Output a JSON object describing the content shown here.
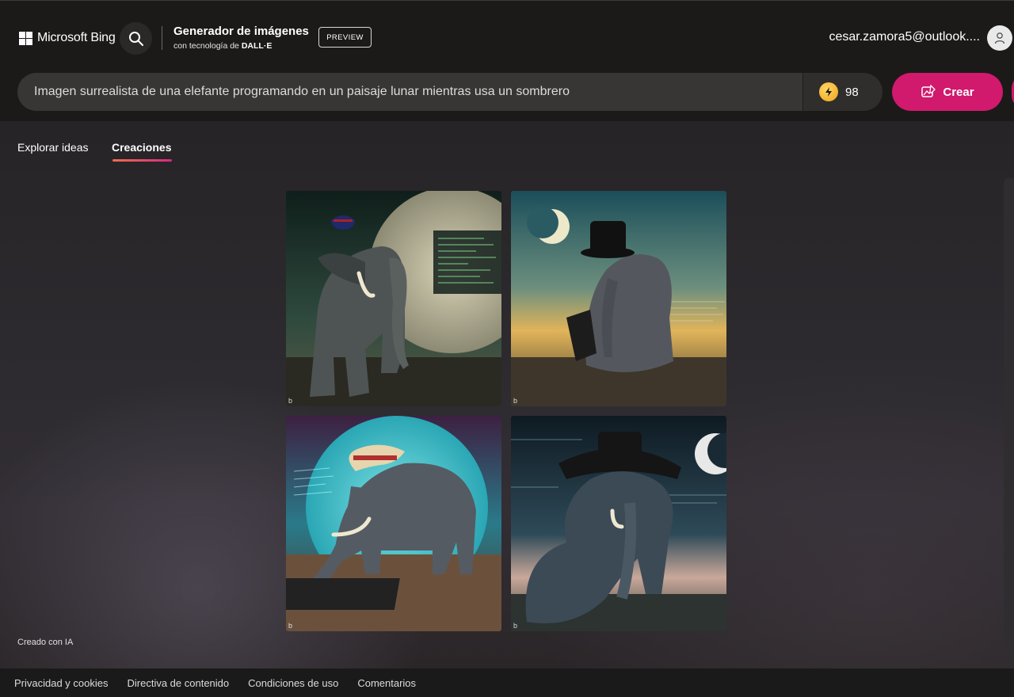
{
  "header": {
    "logo_text": "Microsoft Bing",
    "app_title": "Generador de imágenes",
    "app_subtitle_prefix": "con tecnología de",
    "app_subtitle_brand": "DALL·E",
    "preview_badge": "PREVIEW",
    "user_email": "cesar.zamora5@outlook....",
    "icons": {
      "search": "search-icon",
      "user": "user-icon",
      "logo": "microsoft-logo-icon"
    }
  },
  "prompt": {
    "value": "Imagen surrealista de una elefante programando en un paisaje lunar mientras usa un sombrero",
    "boost_count": "98",
    "create_label": "Crear",
    "icons": {
      "boost": "lightning-coin-icon",
      "create": "create-image-icon"
    }
  },
  "tabs": [
    {
      "label": "Explorar ideas",
      "active": false
    },
    {
      "label": "Creaciones",
      "active": true
    }
  ],
  "gallery": {
    "images": [
      {
        "name": "generated-image-1",
        "watermark": "b"
      },
      {
        "name": "generated-image-2",
        "watermark": "b"
      },
      {
        "name": "generated-image-3",
        "watermark": "b"
      },
      {
        "name": "generated-image-4",
        "watermark": "b"
      }
    ]
  },
  "ai_label": "Creado con IA",
  "footer": {
    "links": [
      "Privacidad y cookies",
      "Directiva de contenido",
      "Condiciones de uso",
      "Comentarios"
    ]
  },
  "colors": {
    "accent": "#d1196d",
    "tab_underline_start": "#f06d4a",
    "tab_underline_end": "#d82a83",
    "topbar_bg": "#1b1a19"
  }
}
